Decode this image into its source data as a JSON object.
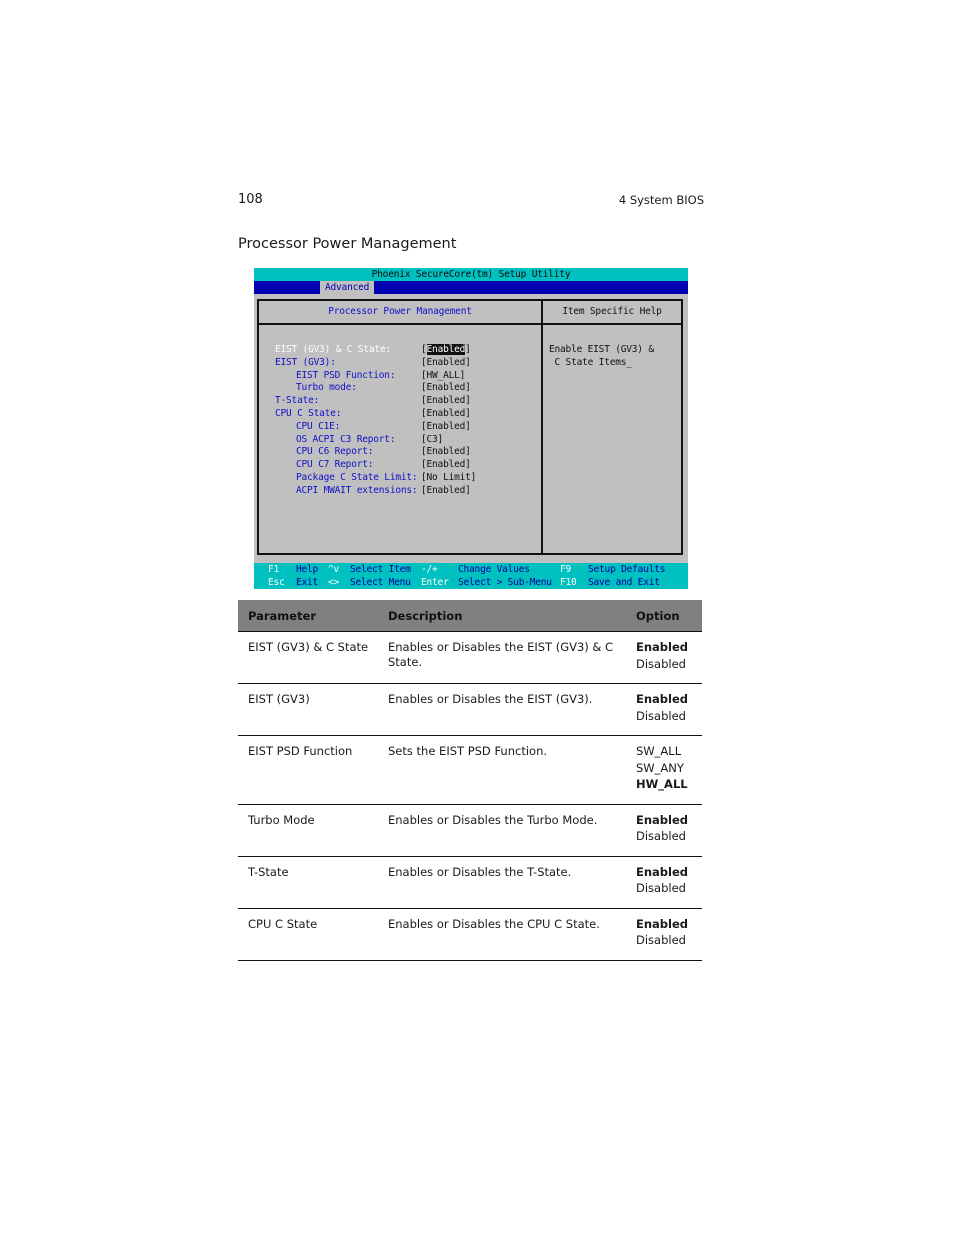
{
  "page": {
    "number": "108",
    "chapter": "4 System BIOS",
    "section_title": "Processor Power Management"
  },
  "bios": {
    "title": "Phoenix SecureCore(tm) Setup Utility",
    "active_tab": "Advanced",
    "panel_title": "Processor Power Management",
    "help_title": "Item Specific Help",
    "help_text": "Enable EIST (GV3) &\n C State Items_",
    "colors": {
      "title_bar": "#00c0c0",
      "menu_bar": "#0000b0",
      "panel_bg": "#c0c0c0",
      "label_text": "#1010c8",
      "footer_bar": "#00c0c0"
    },
    "items": [
      {
        "label": "EIST (GV3) & C State:",
        "value": "[Enabled]",
        "indent": false,
        "selected": true
      },
      {
        "label": "EIST (GV3):",
        "value": "[Enabled]",
        "indent": false,
        "selected": false
      },
      {
        "label": "EIST PSD Function:",
        "value": "[HW_ALL]",
        "indent": true,
        "selected": false
      },
      {
        "label": "Turbo mode:",
        "value": "[Enabled]",
        "indent": true,
        "selected": false
      },
      {
        "label": "T-State:",
        "value": "[Enabled]",
        "indent": false,
        "selected": false
      },
      {
        "label": "CPU C State:",
        "value": "[Enabled]",
        "indent": false,
        "selected": false
      },
      {
        "label": "CPU C1E:",
        "value": "[Enabled]",
        "indent": true,
        "selected": false
      },
      {
        "label": "OS ACPI C3 Report:",
        "value": "[C3]",
        "indent": true,
        "selected": false
      },
      {
        "label": "CPU C6 Report:",
        "value": "[Enabled]",
        "indent": true,
        "selected": false
      },
      {
        "label": "CPU C7 Report:",
        "value": "[Enabled]",
        "indent": true,
        "selected": false
      },
      {
        "label": "Package C State Limit:",
        "value": "[No Limit]",
        "indent": true,
        "selected": false
      },
      {
        "label": "ACPI MWAIT extensions:",
        "value": "[Enabled]",
        "indent": true,
        "selected": false
      }
    ],
    "footer": {
      "row1": [
        {
          "key": "F1",
          "desc": "Help"
        },
        {
          "key": "^v",
          "desc": "Select Item"
        },
        {
          "key": "-/+",
          "desc": "Change Values"
        },
        {
          "key": "F9",
          "desc": "Setup Defaults"
        }
      ],
      "row2": [
        {
          "key": "Esc",
          "desc": "Exit"
        },
        {
          "key": "<>",
          "desc": "Select Menu"
        },
        {
          "key": "Enter",
          "desc": "Select > Sub-Menu"
        },
        {
          "key": "F10",
          "desc": "Save and Exit"
        }
      ]
    }
  },
  "table": {
    "headers": {
      "parameter": "Parameter",
      "description": "Description",
      "option": "Option"
    },
    "rows": [
      {
        "parameter": "EIST (GV3) & C State",
        "description": "Enables or Disables the EIST (GV3) & C State.",
        "options": [
          {
            "text": "Enabled",
            "default": true
          },
          {
            "text": "Disabled",
            "default": false
          }
        ]
      },
      {
        "parameter": "EIST (GV3)",
        "description": "Enables or Disables the EIST (GV3).",
        "options": [
          {
            "text": "Enabled",
            "default": true
          },
          {
            "text": "Disabled",
            "default": false
          }
        ]
      },
      {
        "parameter": "EIST PSD Function",
        "description": "Sets the EIST PSD Function.",
        "options": [
          {
            "text": "SW_ALL",
            "default": false
          },
          {
            "text": "SW_ANY",
            "default": false
          },
          {
            "text": "HW_ALL",
            "default": true
          }
        ]
      },
      {
        "parameter": "Turbo Mode",
        "description": "Enables or Disables the Turbo Mode.",
        "options": [
          {
            "text": "Enabled",
            "default": true
          },
          {
            "text": "Disabled",
            "default": false
          }
        ]
      },
      {
        "parameter": "T-State",
        "description": "Enables or Disables the T-State.",
        "options": [
          {
            "text": "Enabled",
            "default": true
          },
          {
            "text": "Disabled",
            "default": false
          }
        ]
      },
      {
        "parameter": "CPU C State",
        "description": "Enables or Disables the CPU C State.",
        "options": [
          {
            "text": "Enabled",
            "default": true
          },
          {
            "text": "Disabled",
            "default": false
          }
        ]
      }
    ]
  }
}
